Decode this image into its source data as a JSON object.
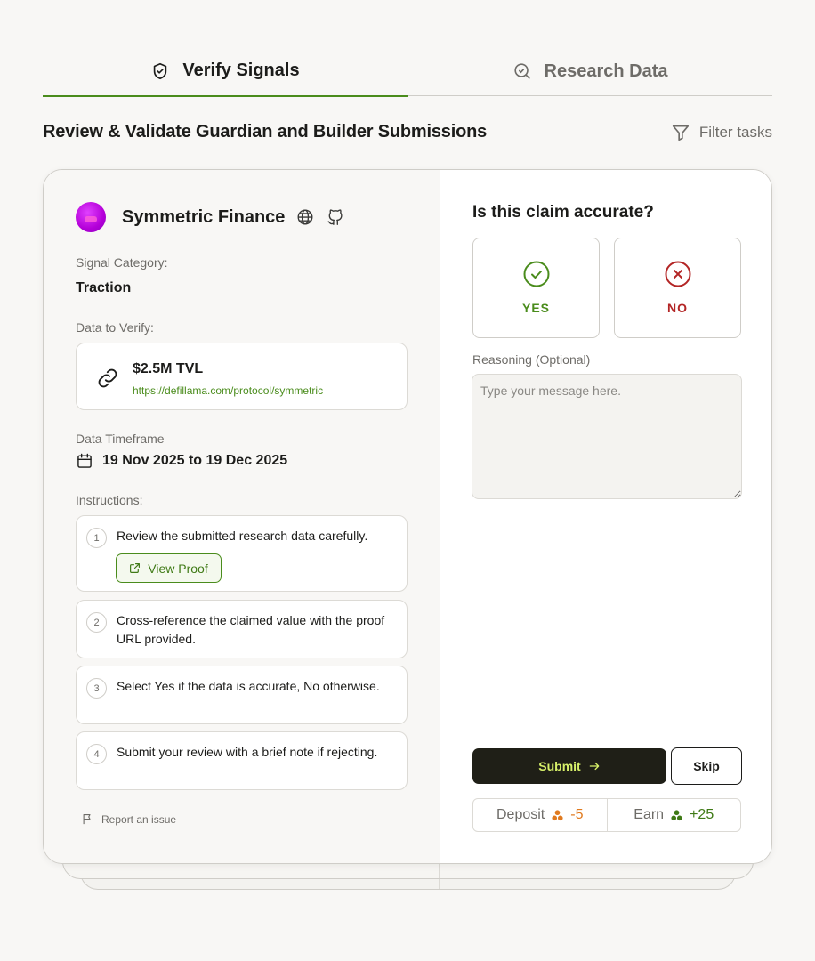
{
  "tabs": [
    {
      "label": "Verify Signals",
      "icon": "shield-check-icon",
      "active": true
    },
    {
      "label": "Research Data",
      "icon": "search-icon",
      "active": false
    }
  ],
  "header": {
    "title": "Review & Validate Guardian and Builder Submissions",
    "filter_label": "Filter tasks"
  },
  "project": {
    "name": "Symmetric Finance",
    "signal_category_label": "Signal Category:",
    "signal_category": "Traction",
    "data_label": "Data to Verify:",
    "data_value": "$2.5M TVL",
    "data_url": "https://defillama.com/protocol/symmetric",
    "timeframe_label": "Data Timeframe",
    "timeframe": "19 Nov 2025 to 19 Dec 2025",
    "instructions_label": "Instructions:",
    "steps": [
      {
        "num": "1",
        "text": "Review the submitted research data carefully."
      },
      {
        "num": "2",
        "text": "Cross-reference the claimed value with the proof URL provided."
      },
      {
        "num": "3",
        "text": "Select Yes if the data is accurate, No otherwise."
      },
      {
        "num": "4",
        "text": "Submit your review with a brief note if rejecting."
      }
    ],
    "view_proof_label": "View Proof",
    "report_label": "Report an issue"
  },
  "review": {
    "question": "Is this claim accurate?",
    "yes_label": "YES",
    "no_label": "NO",
    "reasoning_label": "Reasoning (Optional)",
    "reasoning_placeholder": "Type your message here.",
    "submit_label": "Submit",
    "skip_label": "Skip",
    "deposit_label": "Deposit",
    "deposit_value": "-5",
    "earn_label": "Earn",
    "earn_value": "+25"
  },
  "colors": {
    "accent_green": "#4a8c1c",
    "error_red": "#b32525",
    "deposit_orange": "#e07a1f",
    "submit_bg": "#1f1f17",
    "submit_text": "#d7f06a"
  }
}
